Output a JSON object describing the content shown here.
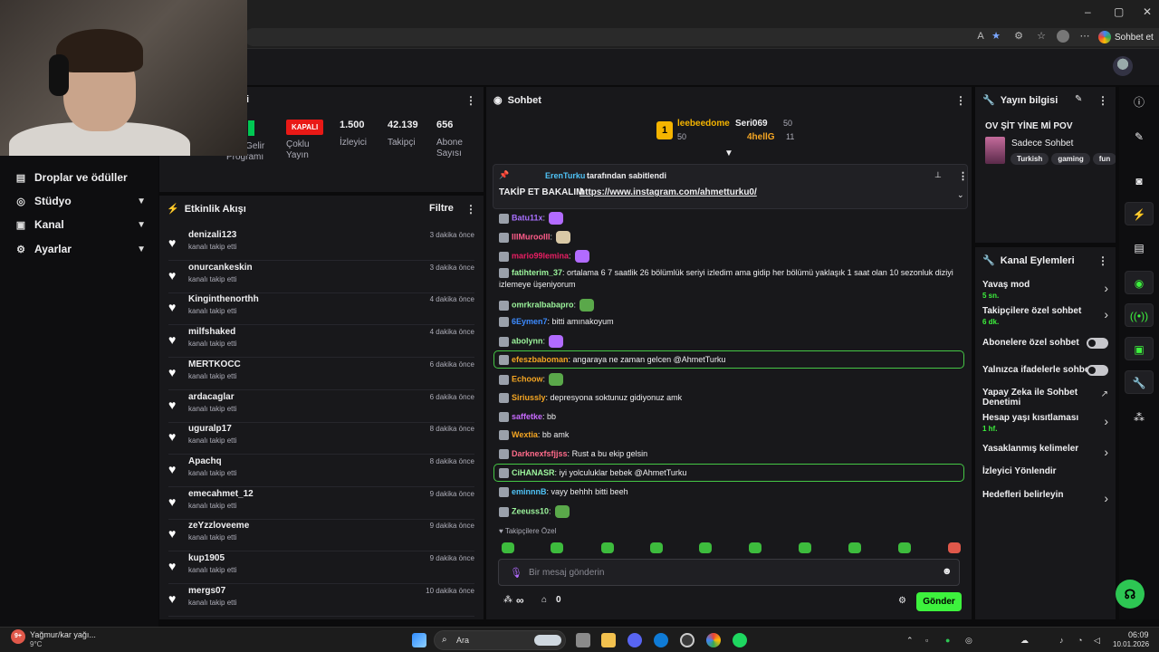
{
  "browser": {
    "copilot_label": "Sohbet et",
    "window_controls": [
      "–",
      "▢",
      "✕"
    ],
    "icons": [
      "read-aloud-icon",
      "favorite-star-icon",
      "extensions-icon",
      "collections-icon",
      "profile-icon",
      "more-icon"
    ]
  },
  "left_nav": {
    "items": [
      {
        "label": "Droplar ve ödüller",
        "icon": "gift-icon",
        "expandable": false
      },
      {
        "label": "Stüdyo",
        "icon": "studio-icon",
        "expandable": true
      },
      {
        "label": "Kanal",
        "icon": "channel-icon",
        "expandable": true
      },
      {
        "label": "Ayarlar",
        "icon": "settings-icon",
        "expandable": true
      }
    ]
  },
  "stats_panel": {
    "partial_title": "i",
    "items": [
      {
        "value": "",
        "label": "erlik Gelir Programı"
      },
      {
        "value": "KAPALI",
        "label": "Çoklu Yayın"
      },
      {
        "value": "1.500",
        "label": "İzleyici"
      },
      {
        "value": "42.139",
        "label": "Takipçi"
      },
      {
        "value": "656",
        "label": "Abone Sayısı"
      }
    ]
  },
  "activity": {
    "title": "Etkinlik Akışı",
    "filter_label": "Filtre",
    "items": [
      {
        "name": "denizali123",
        "sub": "kanalı takip etti",
        "time": "3 dakika önce"
      },
      {
        "name": "onurcankeskin",
        "sub": "kanalı takip etti",
        "time": "3 dakika önce"
      },
      {
        "name": "Kinginthenorthh",
        "sub": "kanalı takip etti",
        "time": "4 dakika önce"
      },
      {
        "name": "milfshaked",
        "sub": "kanalı takip etti",
        "time": "4 dakika önce"
      },
      {
        "name": "MERTKOCC",
        "sub": "kanalı takip etti",
        "time": "6 dakika önce"
      },
      {
        "name": "ardacaglar",
        "sub": "kanalı takip etti",
        "time": "6 dakika önce"
      },
      {
        "name": "uguralp17",
        "sub": "kanalı takip etti",
        "time": "8 dakika önce"
      },
      {
        "name": "Apachq",
        "sub": "kanalı takip etti",
        "time": "8 dakika önce"
      },
      {
        "name": "emecahmet_12",
        "sub": "kanalı takip etti",
        "time": "9 dakika önce"
      },
      {
        "name": "zeYzzloveeme",
        "sub": "kanalı takip etti",
        "time": "9 dakika önce"
      },
      {
        "name": "kup1905",
        "sub": "kanalı takip etti",
        "time": "9 dakika önce"
      },
      {
        "name": "mergs07",
        "sub": "kanalı takip etti",
        "time": "10 dakika önce"
      }
    ]
  },
  "chat": {
    "title": "Sohbet",
    "leaderboard": {
      "rank": "1",
      "top": {
        "name": "leebeedome",
        "count": "50"
      },
      "second": {
        "name": "Seri069",
        "count": "50"
      },
      "third": {
        "name": "4hellG",
        "count": "11"
      }
    },
    "pinned": {
      "pinned_by": "ErenTurku",
      "pinned_suffix": "tarafından sabitlendi",
      "text": "TAKİP ET BAKALIM",
      "link": "https://www.instagram.com/ahmetturku0/"
    },
    "messages": [
      {
        "user": "Batu11x",
        "text": "",
        "color": "#a970ff",
        "emote": "#b26bff"
      },
      {
        "user": "IllMurooIll",
        "text": "",
        "color": "#ff5c8a",
        "emote": "#d9c9a6"
      },
      {
        "user": "mario99lemina",
        "text": "",
        "color": "#e91e63",
        "emote": "#b26bff"
      },
      {
        "user": "fatihterim_37",
        "text": "ortalama 6 7 saatlik 26 bölümlük seriyi izledim ama gidip her bölümü yaklaşık 1 saat olan 10 sezonluk diziyi izlemeye üşeniyorum",
        "color": "#9cf59c",
        "emote": ""
      },
      {
        "user": "omrkralbabapro",
        "text": "",
        "color": "#9cf59c",
        "emote": "#5aa84a"
      },
      {
        "user": "6Eymen7",
        "text": "bitti amınakoyum",
        "color": "#3d8bff",
        "emote": ""
      },
      {
        "user": "abolynn",
        "text": "",
        "color": "#9cf59c",
        "emote": "#b26bff"
      },
      {
        "user": "efeszbaboman",
        "text": "angaraya ne zaman gelcen @AhmetTurku",
        "color": "#f5a623",
        "emote": ""
      },
      {
        "user": "Echoow",
        "text": "",
        "color": "#f5a623",
        "emote": "#5aa84a"
      },
      {
        "user": "Siriussly",
        "text": "depresyona soktunuz gidiyonuz amk",
        "color": "#f5a623",
        "emote": ""
      },
      {
        "user": "saffetke",
        "text": "bb",
        "color": "#c86bff",
        "emote": ""
      },
      {
        "user": "Wextia",
        "text": "bb amk",
        "color": "#f5a623",
        "emote": ""
      },
      {
        "user": "Darknexfsfjjss",
        "text": "Rust a bu ekip gelsin",
        "color": "#ff6b8a",
        "emote": ""
      },
      {
        "user": "CiHANASR",
        "text": "iyi yolculuklar bebek @AhmetTurku",
        "color": "#9cf59c",
        "emote": ""
      },
      {
        "user": "eminnnB",
        "text": "vayy behhh bitti beeh",
        "color": "#4fc3f7",
        "emote": ""
      },
      {
        "user": "Zeeuss10",
        "text": "",
        "color": "#9cf59c",
        "emote": "#5aa84a"
      }
    ],
    "followers_only": "Takipçilere Özel",
    "input_placeholder": "Bir mesaj gönderin",
    "points": "∞",
    "gift_count": "0",
    "send_label": "Gönder"
  },
  "stream_info": {
    "title": "Yayın bilgisi",
    "stream_title": "OV ŞİT YİNE Mİ POV",
    "category": "Sadece Sohbet",
    "tags": [
      "Turkish",
      "gaming",
      "fun"
    ]
  },
  "channel_actions": {
    "title": "Kanal Eylemleri",
    "items": [
      {
        "label": "Yavaş mod",
        "sub": "5 sn.",
        "control": "chevron"
      },
      {
        "label": "Takipçilere özel sohbet",
        "sub": "6 dk.",
        "control": "chevron"
      },
      {
        "label": "Abonelere özel sohbet",
        "sub": "",
        "control": "toggle"
      },
      {
        "label": "Yalnızca ifadelerle sohbet",
        "sub": "",
        "control": "toggle"
      },
      {
        "label": "Yapay Zeka ile Sohbet Denetimi",
        "sub": "",
        "control": "external"
      },
      {
        "label": "Hesap yaşı kısıtlaması",
        "sub": "1 hf.",
        "control": "chevron"
      },
      {
        "label": "Yasaklanmış kelimeler",
        "sub": "",
        "control": "chevron"
      },
      {
        "label": "İzleyici Yönlendir",
        "sub": "",
        "control": "none"
      },
      {
        "label": "Hedefleri belirleyin",
        "sub": "",
        "control": "chevron"
      }
    ]
  },
  "taskbar": {
    "weather": "Yağmur/kar yağı...",
    "temp": "9°C",
    "search_label": "Ara",
    "time": "06:09",
    "date": "10.01.2026",
    "weather_badge": "9+"
  }
}
